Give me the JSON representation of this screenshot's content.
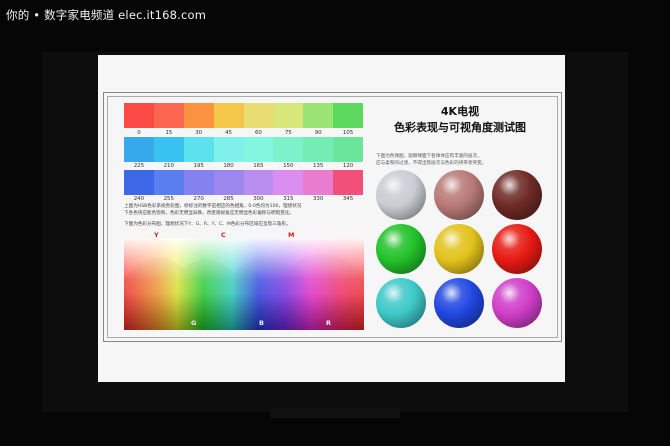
{
  "watermark": "你的 • 数字家电频道 elec.it168.com",
  "test_chart": {
    "title_line1": "4K电视",
    "title_line2": "色彩表现与可视角度测试图",
    "right_note_line1": "下图为色球图，观察球面下各球体应有丰富的层次，",
    "right_note_line2": "应与柔和的过渡，不得出现层次与色彩的块带状突变。",
    "strip1": {
      "colors": [
        "#fa4a46",
        "#fb6650",
        "#fa923f",
        "#f4c64a",
        "#e8dc72",
        "#d8e77a",
        "#9be374",
        "#5cd95e"
      ],
      "labels": [
        "0",
        "15",
        "30",
        "45",
        "60",
        "75",
        "90",
        "105"
      ]
    },
    "strip2": {
      "colors": [
        "#35a9ec",
        "#38c2ef",
        "#5ce2ee",
        "#7ff0ea",
        "#82f6df",
        "#7df1c9",
        "#74ecb4",
        "#69e69a"
      ],
      "labels": [
        "225",
        "210",
        "195",
        "180",
        "165",
        "150",
        "135",
        "120"
      ]
    },
    "strip3": {
      "colors": [
        "#3d69e8",
        "#5a7df0",
        "#8482ee",
        "#9c87ef",
        "#b98ef0",
        "#d98ef0",
        "#ea7cd0",
        "#f05079"
      ],
      "labels": [
        "240",
        "255",
        "270",
        "285",
        "300",
        "315",
        "330",
        "345"
      ]
    },
    "desc_line1": "上图为HSB色彩系统色轮图，标标注的数字是相应的色相角，0-0色均为100，理想状况",
    "desc_line2": "下各色块应能色饱和，色彩无明显异跌，改变观视角应无明显色彩偏移与明暗变化。",
    "desc_line3": "下图为色彩分布图，理想状况下Y、G、R、Y、C、M色彩分布区域应呈现三角形。",
    "spectrum_top_labels": [
      "Y",
      "C",
      "M"
    ],
    "spectrum_bottom_labels": [
      "G",
      "B",
      "R"
    ],
    "spectrum_top_color": "#d61a1a",
    "spectrum_bottom_color": "#f4f4f4",
    "balls": [
      {
        "name": "white-ball",
        "color": "#c9cdd2"
      },
      {
        "name": "pink-ball",
        "color": "#b77a75"
      },
      {
        "name": "brown-ball",
        "color": "#6e2a25"
      },
      {
        "name": "green-ball",
        "color": "#22c22a"
      },
      {
        "name": "yellow-ball",
        "color": "#e2c21c"
      },
      {
        "name": "red-ball",
        "color": "#e61a12"
      },
      {
        "name": "cyan-ball",
        "color": "#3ec8c8"
      },
      {
        "name": "blue-ball",
        "color": "#2147e0"
      },
      {
        "name": "magenta-ball",
        "color": "#cf3ec8"
      }
    ]
  }
}
